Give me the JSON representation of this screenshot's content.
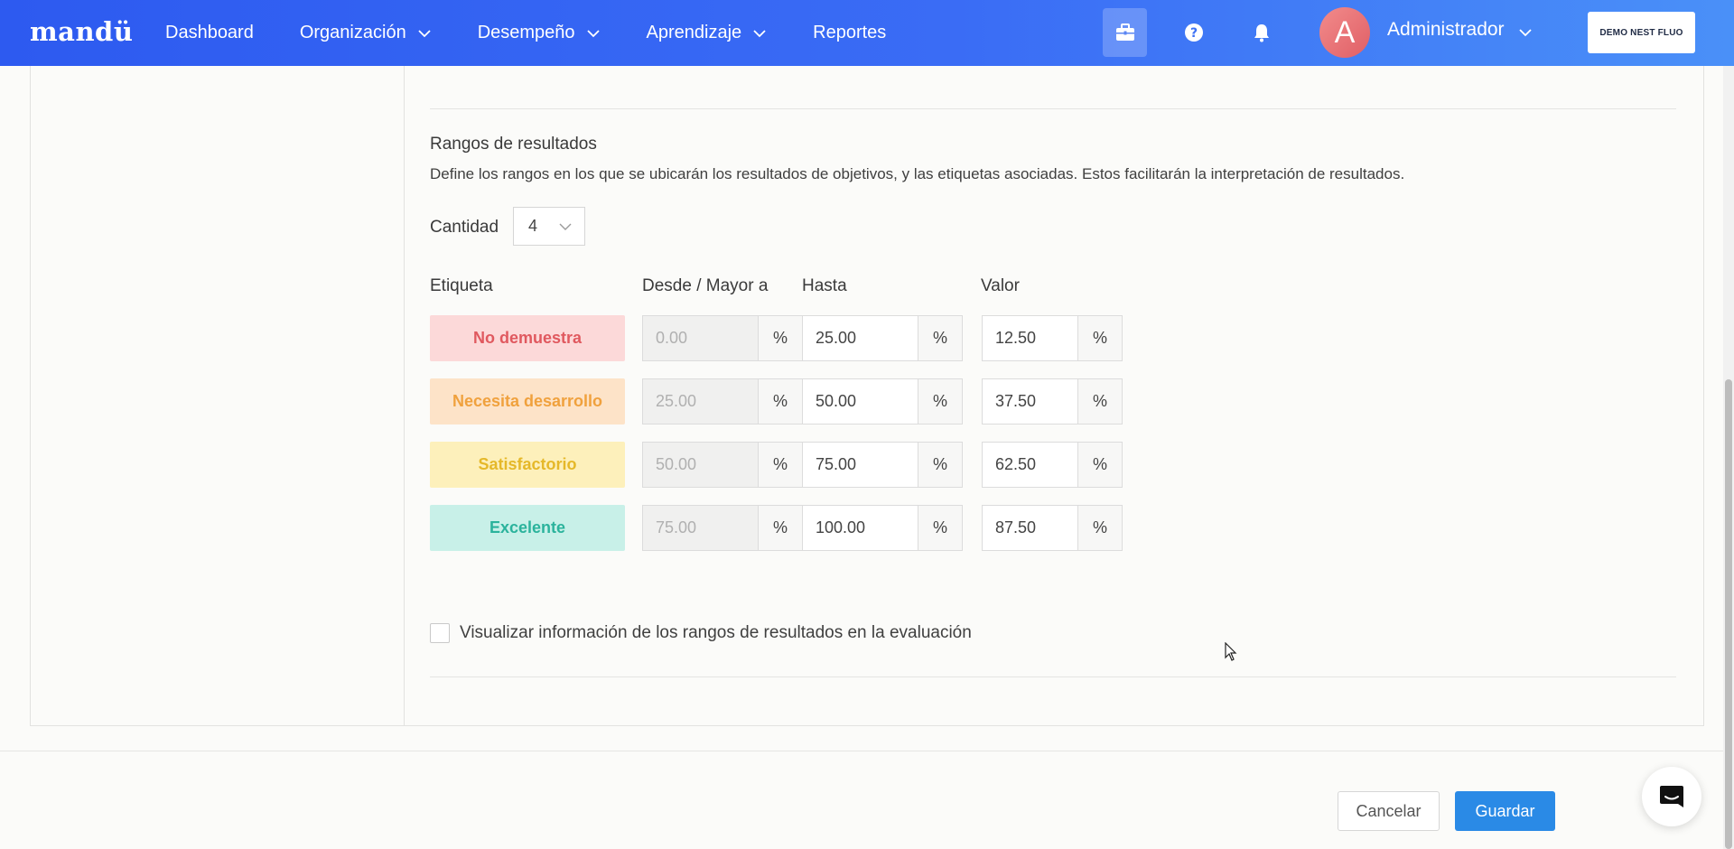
{
  "header": {
    "logo": "mandü",
    "nav": [
      {
        "label": "Dashboard",
        "has_menu": false
      },
      {
        "label": "Organización",
        "has_menu": true
      },
      {
        "label": "Desempeño",
        "has_menu": true
      },
      {
        "label": "Aprendizaje",
        "has_menu": true
      },
      {
        "label": "Reportes",
        "has_menu": false
      }
    ],
    "icons": [
      "briefcase-icon",
      "help-icon",
      "bell-icon"
    ],
    "avatar_letter": "A",
    "user_name": "Administrador",
    "company_button": "DEMO NEST FLUO"
  },
  "section": {
    "title": "Rangos de resultados",
    "description": "Define los rangos en los que se ubicarán los resultados de objetivos, y las etiquetas asociadas. Estos facilitarán la interpretación de resultados.",
    "quantity_label": "Cantidad",
    "quantity_value": "4"
  },
  "table": {
    "headers": {
      "label": "Etiqueta",
      "from": "Desde / Mayor a",
      "to": "Hasta",
      "value": "Valor"
    },
    "unit": "%",
    "rows": [
      {
        "label": "No demuestra",
        "from": "0.00",
        "to": "25.00",
        "value": "12.50",
        "bg": "#fcd9d9",
        "fg": "#e0595f"
      },
      {
        "label": "Necesita desarrollo",
        "from": "25.00",
        "to": "50.00",
        "value": "37.50",
        "bg": "#fde3c8",
        "fg": "#f0a13d"
      },
      {
        "label": "Satisfactorio",
        "from": "50.00",
        "to": "75.00",
        "value": "62.50",
        "bg": "#fdf0bb",
        "fg": "#e5b829"
      },
      {
        "label": "Excelente",
        "from": "75.00",
        "to": "100.00",
        "value": "87.50",
        "bg": "#c8f0e8",
        "fg": "#2bb39c"
      }
    ]
  },
  "option": {
    "label": "Visualizar información de los rangos de resultados en la evaluación",
    "checked": false
  },
  "footer": {
    "cancel": "Cancelar",
    "save": "Guardar"
  },
  "colors": {
    "header_gradient_start": "#2d5af0",
    "header_gradient_end": "#4a90f8",
    "primary_button": "#2a8ae6"
  }
}
